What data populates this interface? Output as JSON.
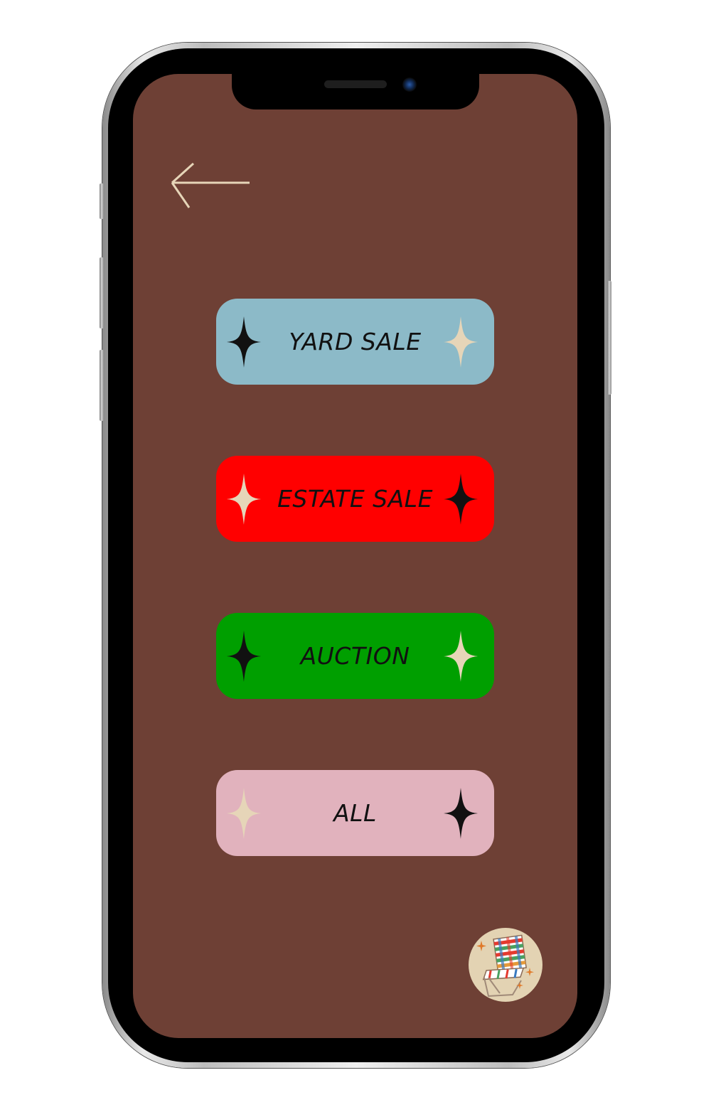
{
  "colors": {
    "screen_background": "#6e4035",
    "accent_cream": "#e6d5b8",
    "sparkle_dark": "#111111"
  },
  "navigation": {
    "back_icon": "arrow-left-icon"
  },
  "categories": [
    {
      "label": "YARD SALE",
      "color": "#8cbac8",
      "left_sparkle": "dark",
      "right_sparkle": "cream"
    },
    {
      "label": "ESTATE SALE",
      "color": "#ff0000",
      "left_sparkle": "cream",
      "right_sparkle": "dark"
    },
    {
      "label": "AUCTION",
      "color": "#009f00",
      "left_sparkle": "dark",
      "right_sparkle": "cream"
    },
    {
      "label": "ALL",
      "color": "#e1b2bd",
      "left_sparkle": "cream",
      "right_sparkle": "dark"
    }
  ],
  "logo": {
    "icon": "lawn-chair-logo-icon"
  }
}
